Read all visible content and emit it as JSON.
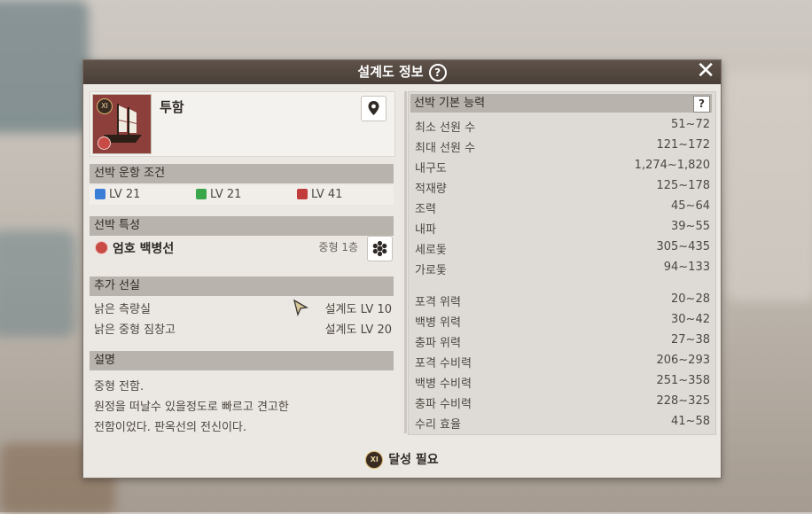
{
  "dialog": {
    "title": "설계도 정보",
    "help_glyph": "?",
    "close_glyph": "✕",
    "footer_text": "달성 필요",
    "footer_icon_text": "XI"
  },
  "ship": {
    "name": "투함",
    "rank_badge": "XI"
  },
  "operation": {
    "header": "선박 운항 조건",
    "requirements": [
      {
        "icon": "adventure-icon",
        "label": "LV 21",
        "color": "#3b7ed8"
      },
      {
        "icon": "trade-icon",
        "label": "LV 21",
        "color": "#3aa64a"
      },
      {
        "icon": "battle-icon",
        "label": "LV 41",
        "color": "#c23b3b"
      }
    ]
  },
  "traits": {
    "header": "선박 특성",
    "name": "엄호 백병선",
    "badge": "중형 1층"
  },
  "cabins": {
    "header": "추가 선실",
    "items": [
      {
        "name": "낡은 측량실",
        "req": "설계도 LV 10"
      },
      {
        "name": "낡은 중형 짐창고",
        "req": "설계도 LV 20"
      }
    ]
  },
  "description": {
    "header": "설명",
    "lines": [
      "중형 전함.",
      "원정을 떠날수 있을정도로 빠르고 견고한",
      "전함이었다. 판옥선의 전신이다."
    ]
  },
  "stats": {
    "header": "선박 기본 능력",
    "help_glyph": "?",
    "group1": [
      {
        "label": "최소 선원 수",
        "value": "51~72"
      },
      {
        "label": "최대 선원 수",
        "value": "121~172"
      },
      {
        "label": "내구도",
        "value": "1,274~1,820"
      },
      {
        "label": "적재량",
        "value": "125~178"
      },
      {
        "label": "조력",
        "value": "45~64"
      },
      {
        "label": "내파",
        "value": "39~55"
      },
      {
        "label": "세로돛",
        "value": "305~435"
      },
      {
        "label": "가로돛",
        "value": "94~133"
      }
    ],
    "group2": [
      {
        "label": "포격 위력",
        "value": "20~28"
      },
      {
        "label": "백병 위력",
        "value": "30~42"
      },
      {
        "label": "충파 위력",
        "value": "27~38"
      },
      {
        "label": "포격 수비력",
        "value": "206~293"
      },
      {
        "label": "백병 수비력",
        "value": "251~358"
      },
      {
        "label": "충파 수비력",
        "value": "228~325"
      },
      {
        "label": "수리 효율",
        "value": "41~58"
      }
    ]
  }
}
